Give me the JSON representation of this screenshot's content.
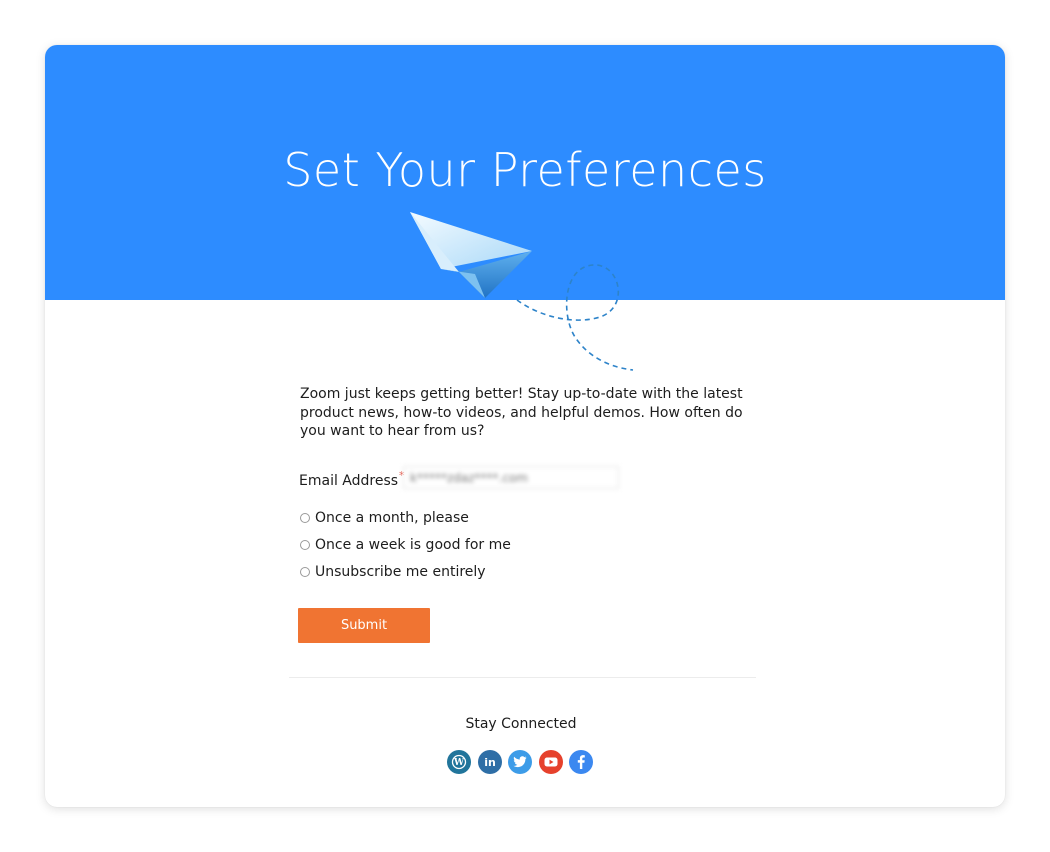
{
  "header": {
    "title": "Set Your Preferences",
    "background_color": "#2d8cff"
  },
  "form": {
    "intro_text": "Zoom just keeps getting better! Stay up-to-date with the latest product news, how-to videos, and helpful demos. How often do you want to hear from us?",
    "email_label": "Email Address",
    "required_marker": "*",
    "email_value": "k*****zdaz****.com",
    "options": [
      {
        "label": "Once a month, please",
        "selected": false
      },
      {
        "label": "Once a week is good for me",
        "selected": false
      },
      {
        "label": "Unsubscribe me entirely",
        "selected": false
      }
    ],
    "submit_label": "Submit",
    "submit_color": "#f07432"
  },
  "footer": {
    "stay_connected": "Stay Connected",
    "social": [
      {
        "name": "wordpress-icon",
        "color": "#21759b",
        "glyph": "W"
      },
      {
        "name": "linkedin-icon",
        "color": "#2e6ea6",
        "glyph": "in"
      },
      {
        "name": "twitter-icon",
        "color": "#3d9ce8",
        "glyph": "twitter"
      },
      {
        "name": "youtube-icon",
        "color": "#e6412c",
        "glyph": "play"
      },
      {
        "name": "facebook-icon",
        "color": "#3b88f0",
        "glyph": "f"
      }
    ]
  }
}
